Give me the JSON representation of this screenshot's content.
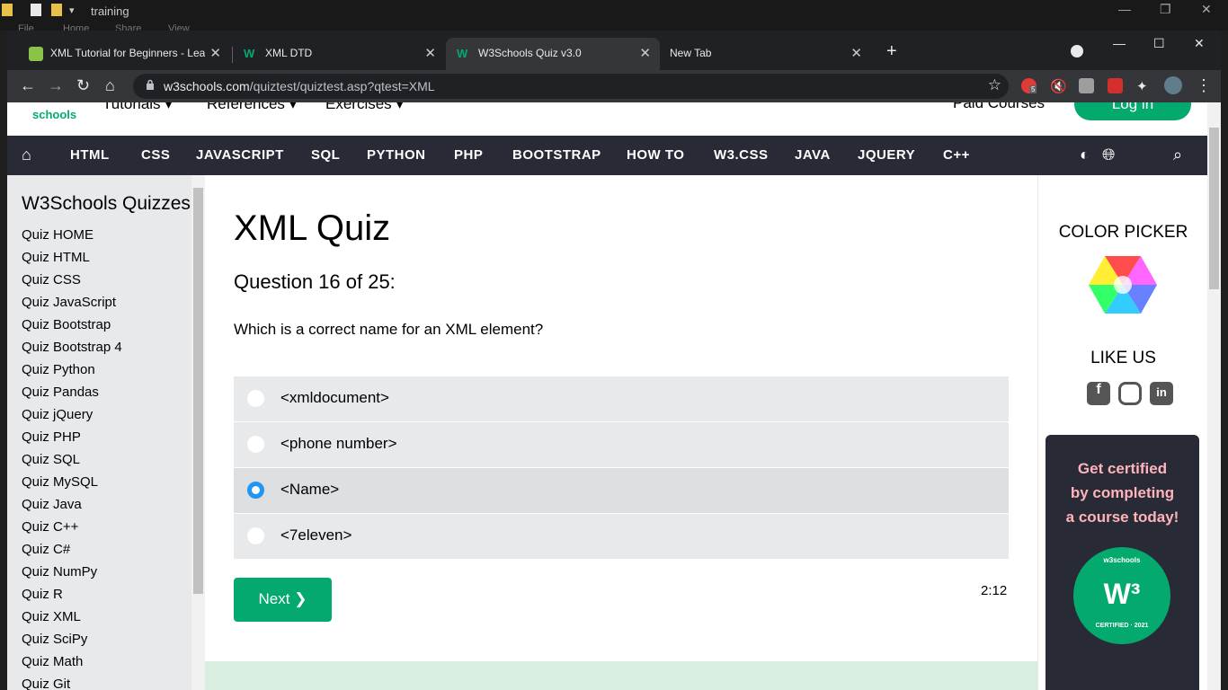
{
  "explorer": {
    "title": "training",
    "menu": [
      "File",
      "Home",
      "Share",
      "View"
    ]
  },
  "tabs": [
    {
      "label": "XML Tutorial for Beginners - Lear",
      "close": "✕"
    },
    {
      "label": "XML DTD",
      "close": "✕"
    },
    {
      "label": "W3Schools Quiz v3.0",
      "close": "✕"
    },
    {
      "label": "New Tab",
      "close": "✕"
    }
  ],
  "address": {
    "host": "w3schools.com",
    "path": "/quiztest/quiztest.asp?qtest=XML"
  },
  "extensions": {
    "badge_count": "5"
  },
  "site_header": {
    "logo_text": "schools",
    "menus": [
      "Tutorials ▾",
      "References ▾",
      "Exercises ▾"
    ],
    "paid_courses": "Paid Courses",
    "login": "Log in"
  },
  "topnav": [
    "HTML",
    "CSS",
    "JAVASCRIPT",
    "SQL",
    "PYTHON",
    "PHP",
    "BOOTSTRAP",
    "HOW TO",
    "W3.CSS",
    "JAVA",
    "JQUERY",
    "C++"
  ],
  "sidebar": {
    "title": "W3Schools Quizzes",
    "items": [
      "Quiz HOME",
      "Quiz HTML",
      "Quiz CSS",
      "Quiz JavaScript",
      "Quiz Bootstrap",
      "Quiz Bootstrap 4",
      "Quiz Python",
      "Quiz Pandas",
      "Quiz jQuery",
      "Quiz PHP",
      "Quiz SQL",
      "Quiz MySQL",
      "Quiz Java",
      "Quiz C++",
      "Quiz C#",
      "Quiz NumPy",
      "Quiz R",
      "Quiz XML",
      "Quiz SciPy",
      "Quiz Math",
      "Quiz Git"
    ]
  },
  "quiz": {
    "title": "XML Quiz",
    "question_number": "Question 16 of 25:",
    "question": "Which is a correct name for an XML element?",
    "options": [
      "<xmldocument>",
      "<phone number>",
      "<Name>",
      "<7eleven>"
    ],
    "selected_index": 2,
    "next_label": "Next ❯",
    "timer": "2:12"
  },
  "right": {
    "color_picker": "COLOR PICKER",
    "like_us": "LIKE US",
    "promo": [
      "Get certified",
      "by completing",
      "a course today!"
    ],
    "cert_badge_top": "w3schools",
    "cert_badge_bottom": "CERTIFIED · 2021"
  },
  "colors": {
    "brand": "#04aa6d",
    "nav_bg": "#282a35",
    "sidebar_bg": "#e7e9eb",
    "promo_text": "#ffb3bb",
    "radio_selected": "#2196f3"
  }
}
